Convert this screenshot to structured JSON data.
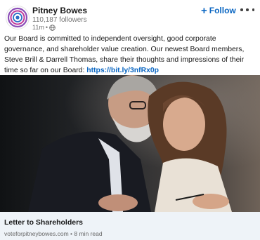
{
  "author": {
    "name": "Pitney Bowes",
    "followers": "110,187 followers",
    "time": "11m",
    "separator": "•",
    "visibility_icon": "globe-icon"
  },
  "actions": {
    "follow_icon": "+",
    "follow_label": "Follow",
    "more_icon": "more-horizontal-icon"
  },
  "post": {
    "text": "Our Board is committed to independent oversight, good corporate governance, and shareholder value creation. Our newest Board members, Steve Brill & Darrell Thomas, share their thoughts and impressions of their time so far on our Board:",
    "link": "https://bit.ly/3nfRx0p"
  },
  "link_card": {
    "title": "Letter to Shareholders",
    "domain": "voteforpitneybowes.com",
    "separator": "•",
    "read_time": "8 min read"
  },
  "colors": {
    "accent": "#0a66c2",
    "text": "#191919",
    "muted": "#757575",
    "card_bg": "#eef3f8"
  }
}
